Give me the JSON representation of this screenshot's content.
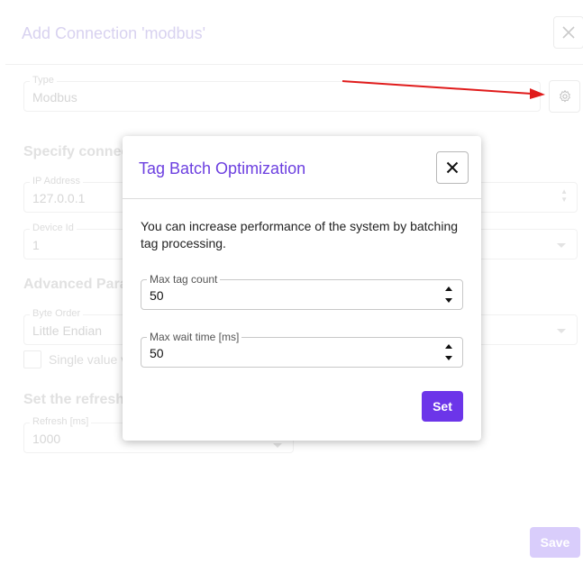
{
  "background": {
    "title": "Add Connection 'modbus'",
    "type_field": {
      "label": "Type",
      "value": "Modbus"
    },
    "section_connection": "Specify connec",
    "ip_field": {
      "label": "IP Address",
      "value": "127.0.0.1"
    },
    "device_field": {
      "label": "Device Id",
      "value": "1"
    },
    "section_advanced": "Advanced Para",
    "byte_order_field": {
      "label": "Byte Order",
      "value": "Little Endian"
    },
    "checkbox_label": "Single value v",
    "section_refresh": "Set the refresh",
    "refresh_field": {
      "label": "Refresh [ms]",
      "value": "1000"
    },
    "save_label": "Save"
  },
  "modal": {
    "title": "Tag Batch Optimization",
    "description": "You can increase performance of the system by batching tag processing.",
    "max_tag_count": {
      "label": "Max tag count",
      "value": "50"
    },
    "max_wait_time": {
      "label": "Max wait time [ms]",
      "value": "50"
    },
    "set_label": "Set"
  },
  "colors": {
    "accent": "#6c35e9",
    "title_accent": "#6c3fe0",
    "annotation_arrow": "#e01b1b"
  }
}
